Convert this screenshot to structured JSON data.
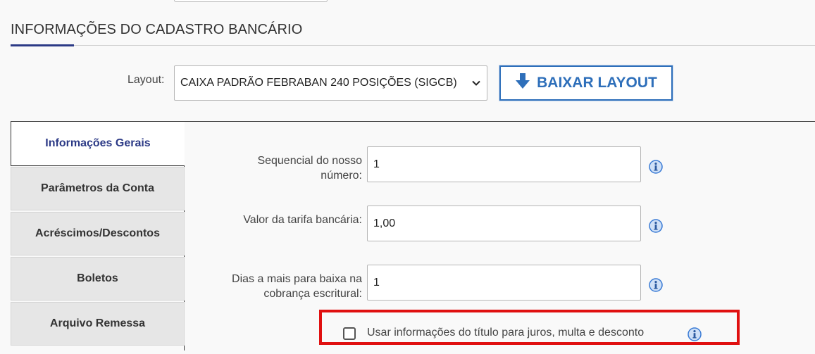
{
  "section": {
    "title": "INFORMAÇÕES DO CADASTRO BANCÁRIO"
  },
  "layout": {
    "label": "Layout:",
    "selected": "CAIXA PADRÃO FEBRABAN 240 POSIÇÕES (SIGCB)",
    "download_label": "BAIXAR LAYOUT"
  },
  "tabs": [
    {
      "label": "Informações Gerais",
      "active": true
    },
    {
      "label": "Parâmetros da Conta",
      "active": false
    },
    {
      "label": "Acréscimos/Descontos",
      "active": false
    },
    {
      "label": "Boletos",
      "active": false
    },
    {
      "label": "Arquivo Remessa",
      "active": false
    }
  ],
  "fields": {
    "sequencial": {
      "label_line1": "Sequencial do nosso",
      "label_line2": "número:",
      "value": "1"
    },
    "tarifa": {
      "label": "Valor da tarifa bancária:",
      "value": "1,00"
    },
    "dias": {
      "label_line1": "Dias a mais para baixa na",
      "label_line2": "cobrança escritural:",
      "value": "1"
    }
  },
  "checkbox": {
    "label": "Usar informações do título para juros, multa e desconto",
    "checked": false
  },
  "colors": {
    "accent": "#2c3a86",
    "button": "#2e6fba",
    "highlight": "#e01010",
    "info_icon": "#3a7bd5"
  }
}
